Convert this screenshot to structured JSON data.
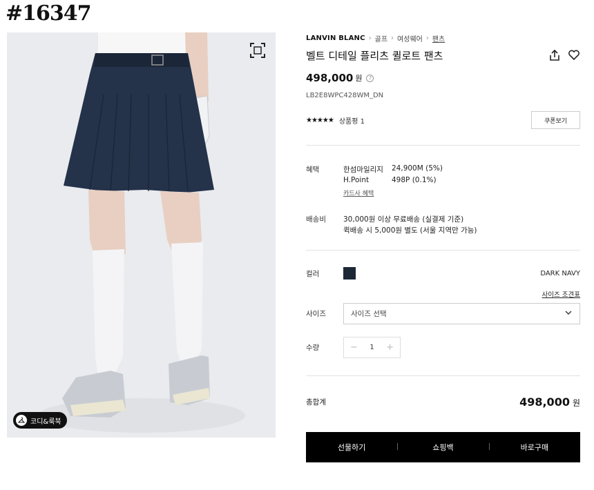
{
  "watermark": "#16347",
  "image": {
    "lookbook_label": "코디&룩북"
  },
  "breadcrumb": {
    "brand": "LANVIN BLANC",
    "items": [
      "골프",
      "여성웨어",
      "팬츠"
    ]
  },
  "product": {
    "title": "벨트 디테일 플리츠 퀼로트 팬츠",
    "price": "498,000",
    "currency": "원",
    "sku": "LB2E8WPC428WM_DN",
    "stars": "★★★★★",
    "review_label": "상품평 1",
    "coupon_label": "쿠폰보기"
  },
  "benefits": {
    "label": "혜택",
    "rows": [
      {
        "name": "한섬마일리지",
        "value": "24,900M (5%)"
      },
      {
        "name": "H.Point",
        "value": "498P (0.1%)"
      }
    ],
    "card_link": "카드사 혜택"
  },
  "shipping": {
    "label": "배송비",
    "line1": "30,000원 이상 무료배송 (실결제 기준)",
    "line2": "퀵배송 시 5,000원 별도 (서울 지역만 가능)"
  },
  "options": {
    "color_label": "컬러",
    "color_hex": "#1d2836",
    "color_name": "DARK NAVY",
    "size_guide": "사이즈 조견표",
    "size_label": "사이즈",
    "size_placeholder": "사이즈 선택",
    "qty_label": "수량",
    "qty_value": "1"
  },
  "total": {
    "label": "총합계",
    "value": "498,000",
    "currency": "원"
  },
  "buttons": {
    "gift": "선물하기",
    "cart": "쇼핑백",
    "buy": "바로구매"
  }
}
